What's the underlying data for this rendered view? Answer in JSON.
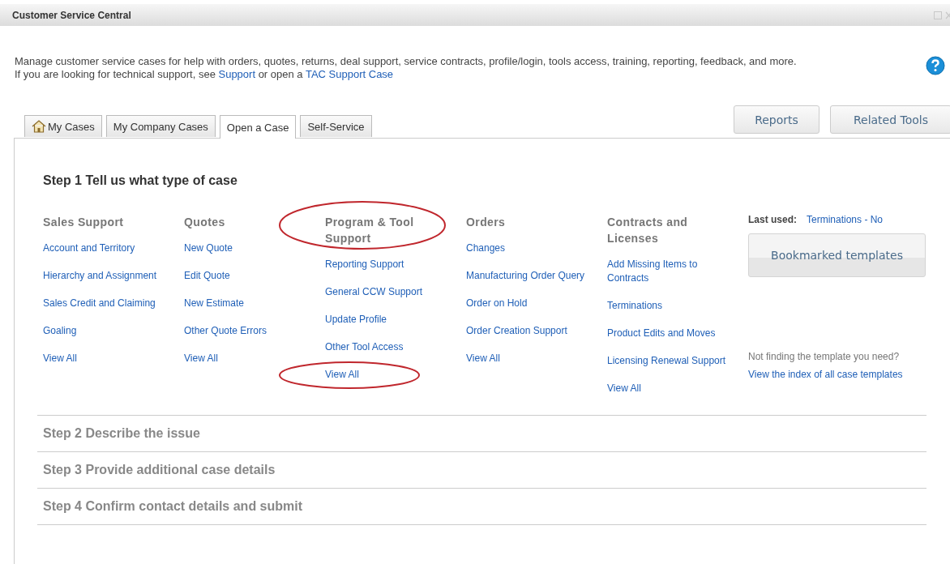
{
  "window": {
    "title": "Customer Service Central"
  },
  "description": [
    {
      "kind": "text",
      "text": "Manage customer service cases for help with orders, quotes, returns, deal support, service contracts, profile/login, tools access, training, reporting, feedback, and more. If you are looking for technical support, see "
    },
    {
      "kind": "link",
      "text": "Support"
    },
    {
      "kind": "text",
      "text": " or open a "
    },
    {
      "kind": "link",
      "text": "TAC Support Case"
    }
  ],
  "tabs": [
    {
      "label": "My Cases",
      "selected": false
    },
    {
      "label": "My Company Cases",
      "selected": false
    },
    {
      "label": "Open a Case",
      "selected": true
    },
    {
      "label": "Self-Service",
      "selected": false
    }
  ],
  "header_buttons": [
    "Reports",
    "Related Tools"
  ],
  "steps": [
    {
      "title": "Step 1 Tell us what type of case",
      "expanded": true
    },
    {
      "title": "Step 2 Describe the issue",
      "expanded": false
    },
    {
      "title": "Step 3 Provide additional case details",
      "expanded": false
    },
    {
      "title": "Step 4 Confirm contact details and submit",
      "expanded": false
    }
  ],
  "categories": [
    {
      "heading": "Sales Support",
      "circled": false,
      "items": [
        {
          "label": "Account and Territory",
          "circled": false
        },
        {
          "label": "Hierarchy and Assignment",
          "circled": false
        },
        {
          "label": "Sales Credit and Claiming",
          "circled": false
        },
        {
          "label": "Goaling",
          "circled": false
        },
        {
          "label": "View All",
          "circled": false
        }
      ]
    },
    {
      "heading": "Quotes",
      "circled": false,
      "items": [
        {
          "label": "New Quote",
          "circled": false
        },
        {
          "label": "Edit Quote",
          "circled": false
        },
        {
          "label": "New Estimate",
          "circled": false
        },
        {
          "label": "Other Quote Errors",
          "circled": false
        },
        {
          "label": "View All",
          "circled": false
        }
      ]
    },
    {
      "heading": "Program & Tool Support",
      "circled": true,
      "items": [
        {
          "label": "Reporting Support",
          "circled": false
        },
        {
          "label": "General CCW Support",
          "circled": false
        },
        {
          "label": "Update Profile",
          "circled": false
        },
        {
          "label": "Other Tool Access",
          "circled": false
        },
        {
          "label": "View All",
          "circled": true
        }
      ]
    },
    {
      "heading": "Orders",
      "circled": false,
      "items": [
        {
          "label": "Changes",
          "circled": false
        },
        {
          "label": "Manufacturing Order Query",
          "circled": false
        },
        {
          "label": "Order on Hold",
          "circled": false
        },
        {
          "label": "Order Creation Support",
          "circled": false
        },
        {
          "label": "View All",
          "circled": false
        }
      ]
    },
    {
      "heading": "Contracts and Licenses",
      "circled": false,
      "items": [
        {
          "label": "Add Missing Items to Contracts",
          "circled": false
        },
        {
          "label": "Terminations",
          "circled": false
        },
        {
          "label": "Product Edits and Moves",
          "circled": false
        },
        {
          "label": "Licensing Renewal Support",
          "circled": false
        },
        {
          "label": "View All",
          "circled": false
        }
      ]
    }
  ],
  "side": {
    "last_used_label": "Last used:",
    "last_used_value": "Terminations - No",
    "bookmark_button": "Bookmarked templates",
    "not_finding": "Not finding the template you need?",
    "index_link": "View the index of all case templates"
  }
}
